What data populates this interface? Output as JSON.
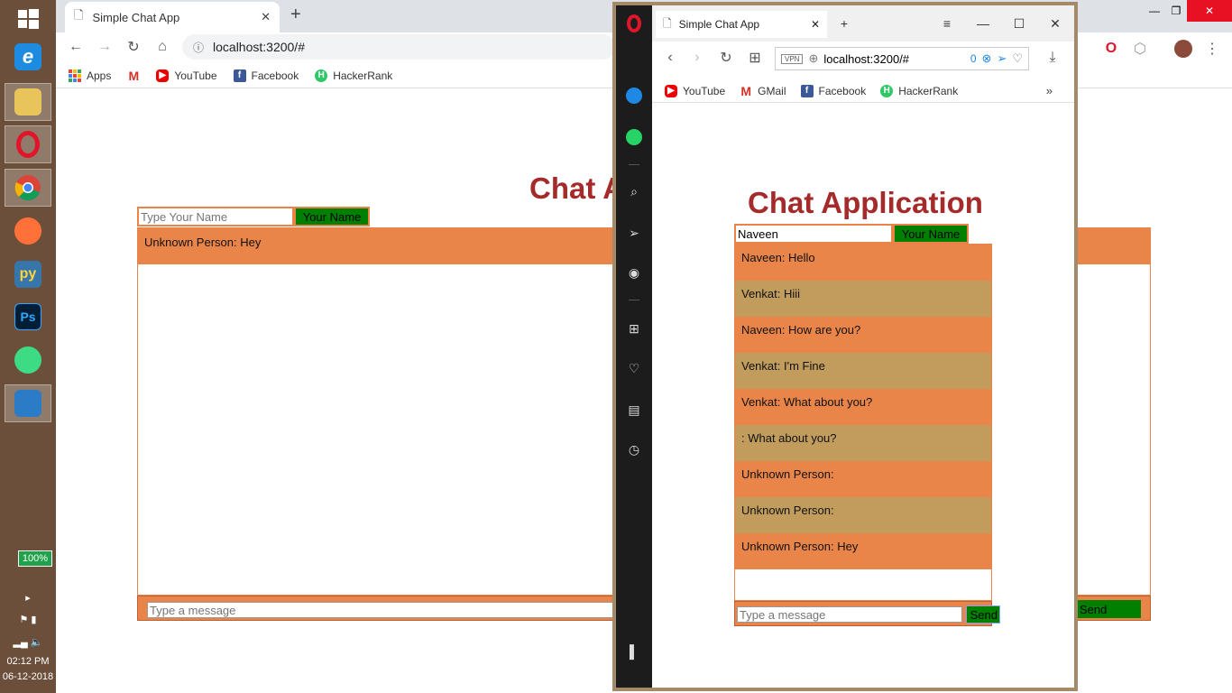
{
  "taskbar": {
    "apps": [
      "windows-start",
      "internet-explorer",
      "file-explorer",
      "opera",
      "chrome",
      "firefox",
      "python",
      "photoshop",
      "android-studio",
      "vscode"
    ],
    "battery": "100%",
    "time": "02:12 PM",
    "date": "06-12-2018"
  },
  "chrome": {
    "tab_title": "Simple Chat App",
    "url": "localhost:3200/#",
    "bookmarks": [
      "Apps",
      "",
      "YouTube",
      "Facebook",
      "HackerRank"
    ],
    "app": {
      "title": "Chat Application",
      "name_placeholder": "Type Your Name",
      "name_button": "Your Name",
      "messages": [
        "Unknown Person: Hey"
      ],
      "message_placeholder": "Type a message",
      "send_label": "Send"
    }
  },
  "opera": {
    "tab_title": "Simple Chat App",
    "url": "localhost:3200/#",
    "badge_count": "0",
    "bookmarks": [
      "YouTube",
      "GMail",
      "Facebook",
      "HackerRank"
    ],
    "app": {
      "title": "Chat Application",
      "name_value": "Naveen",
      "name_button": "Your Name",
      "messages": [
        "Naveen: Hello",
        "Venkat: Hiii",
        "Naveen: How are you?",
        "Venkat: I'm Fine",
        "Venkat: What about you?",
        ": What about you?",
        "Unknown Person:",
        "Unknown Person:",
        "Unknown Person: Hey"
      ],
      "message_placeholder": "Type a message",
      "send_label": "Send"
    }
  },
  "colors": {
    "title": "#a52a2a",
    "message_orange": "#ea8549",
    "message_tan": "#c19c5c",
    "button_green": "#008000"
  }
}
